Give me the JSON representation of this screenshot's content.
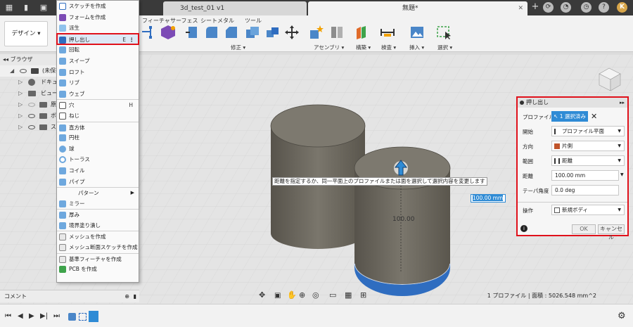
{
  "window": {
    "tabs": [
      {
        "label": "3d_test_01 v1"
      },
      {
        "label": "無題*"
      }
    ],
    "user_initials": "K"
  },
  "ribbon": {
    "workspace_button": "デザイン ▾",
    "tabs": [
      "フィーチャ",
      "サーフェス",
      "シートメタル",
      "ツール"
    ],
    "groups": [
      "修正 ▾",
      "アセンブリ ▾",
      "構築 ▾",
      "検査 ▾",
      "挿入 ▾",
      "選択 ▾"
    ]
  },
  "browser": {
    "title": "ブラウザ",
    "rows": [
      {
        "label": "(未保存)"
      },
      {
        "label": "ドキュメ"
      },
      {
        "label": "ビュー"
      },
      {
        "label": "原"
      },
      {
        "label": "ボ"
      },
      {
        "label": "ス"
      }
    ]
  },
  "menu": {
    "items": [
      {
        "label": "スケッチを作成",
        "shortcut": ""
      },
      {
        "label": "フォームを作成",
        "shortcut": ""
      },
      {
        "label": "派生",
        "shortcut": ""
      },
      {
        "label": "押し出し",
        "shortcut": "E",
        "highlighted": true
      },
      {
        "label": "回転",
        "shortcut": ""
      },
      {
        "label": "スイープ",
        "shortcut": ""
      },
      {
        "label": "ロフト",
        "shortcut": ""
      },
      {
        "label": "リブ",
        "shortcut": ""
      },
      {
        "label": "ウェブ",
        "shortcut": ""
      },
      {
        "label": "穴",
        "shortcut": "H"
      },
      {
        "label": "ねじ",
        "shortcut": ""
      },
      {
        "label": "直方体",
        "shortcut": ""
      },
      {
        "label": "円柱",
        "shortcut": ""
      },
      {
        "label": "球",
        "shortcut": ""
      },
      {
        "label": "トーラス",
        "shortcut": ""
      },
      {
        "label": "コイル",
        "shortcut": ""
      },
      {
        "label": "パイプ",
        "shortcut": ""
      },
      {
        "label": "パターン",
        "shortcut": ""
      },
      {
        "label": "ミラー",
        "shortcut": ""
      },
      {
        "label": "厚み",
        "shortcut": ""
      },
      {
        "label": "境界塗り潰し",
        "shortcut": ""
      },
      {
        "label": "メッシュを作成",
        "shortcut": ""
      },
      {
        "label": "メッシュ断面スケッチを作成",
        "shortcut": ""
      },
      {
        "label": "基準フィーチャを作成",
        "shortcut": ""
      },
      {
        "label": "PCB を作成",
        "shortcut": ""
      }
    ]
  },
  "viewport": {
    "hint": "距離を指定するか、同一平面上のプロファイルまたは面を選択して選択内容を変更します",
    "dimension_label": "100.00",
    "distance_input": "100.00 mm"
  },
  "dialog": {
    "title": "押し出し",
    "profile_label": "プロファイル",
    "profile_selected": "1 選択済み",
    "start_label": "開始",
    "start_value": "プロファイル平面",
    "direction_label": "方向",
    "direction_value": "片側",
    "extent_label": "範囲",
    "extent_value": "距離",
    "distance_label": "距離",
    "distance_value": "100.00 mm",
    "taper_label": "テーパ角度",
    "taper_value": "0.0 deg",
    "operation_label": "操作",
    "operation_value": "新規ボディ",
    "ok_label": "OK",
    "cancel_label": "キャンセル"
  },
  "status": {
    "comment_label": "コメント",
    "measure_text": "1 プロファイル | 面積 : 5026.548 mm^2"
  },
  "colors": {
    "highlight_red": "#e0111b",
    "accent_blue": "#2f8bd5",
    "cylinder_gray": "#6f6b61",
    "selected_face": "#2f6dc0"
  }
}
